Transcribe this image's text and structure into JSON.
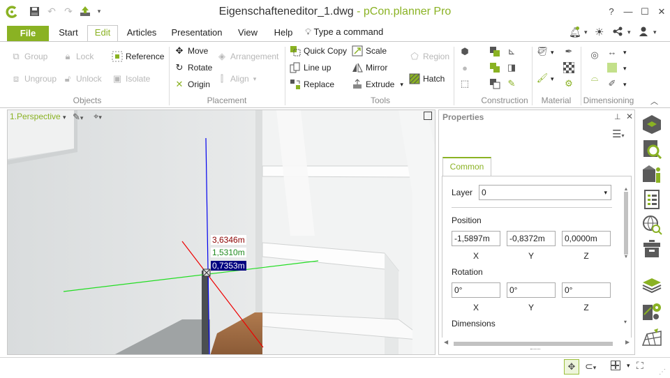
{
  "window": {
    "title_file": "Eigenschafteneditor_1.dwg",
    "title_sep": " - ",
    "title_app": "pCon.planner Pro",
    "help": "?",
    "min": "—",
    "max": "☐",
    "close": "✕"
  },
  "menu": {
    "file": "File",
    "start": "Start",
    "edit": "Edit",
    "articles": "Articles",
    "presentation": "Presentation",
    "view": "View",
    "help": "Help",
    "command": "Type a command"
  },
  "ribbon": {
    "objects": {
      "group": "Group",
      "lock": "Lock",
      "ungroup": "Ungroup",
      "unlock": "Unlock",
      "reference": "Reference",
      "isolate": "Isolate",
      "label": "Objects"
    },
    "placement": {
      "move": "Move",
      "rotate": "Rotate",
      "origin": "Origin",
      "arrangement": "Arrangement",
      "align": "Align",
      "label": "Placement"
    },
    "tools": {
      "quick_copy": "Quick Copy",
      "line_up": "Line up",
      "replace": "Replace",
      "scale": "Scale",
      "mirror": "Mirror",
      "extrude": "Extrude",
      "region": "Region",
      "hatch": "Hatch",
      "label": "Tools"
    },
    "construction": {
      "label": "Construction"
    },
    "material": {
      "label": "Material"
    },
    "dimensioning": {
      "label": "Dimensioning"
    }
  },
  "viewport": {
    "name": "1.Perspective",
    "coord_x": "3,6346m",
    "coord_y": "1,5310m",
    "coord_z": "0,7353m"
  },
  "properties": {
    "title": "Properties",
    "tab": "Common",
    "layer_label": "Layer",
    "layer_value": "0",
    "position_label": "Position",
    "pos_x": "-1,5897m",
    "pos_y": "-0,8372m",
    "pos_z": "0,0000m",
    "rotation_label": "Rotation",
    "rot_x": "0°",
    "rot_y": "0°",
    "rot_z": "0°",
    "ax_x": "X",
    "ax_y": "Y",
    "ax_z": "Z",
    "dimensions_label": "Dimensions"
  },
  "colors": {
    "accent": "#8ab223",
    "x_axis": "#8b0000",
    "y_axis": "#1e8a1e",
    "z_axis": "#000080"
  }
}
